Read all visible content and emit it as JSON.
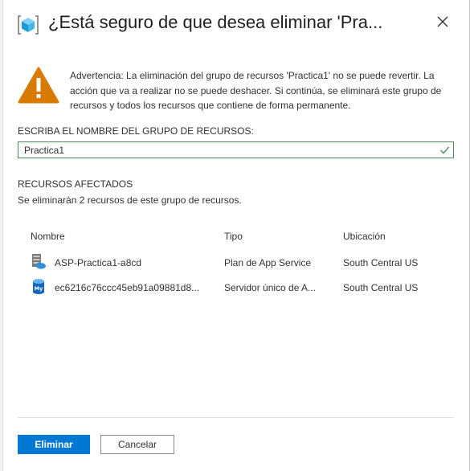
{
  "dialog": {
    "title": "¿Está seguro de que desea eliminar 'Pra...",
    "close_icon": "close-icon"
  },
  "warning": {
    "icon": "warning-icon",
    "color": "#d97a00",
    "text": "Advertencia: La eliminación del grupo de recursos 'Practica1' no se puede revertir. La acción que va a realizar no se puede deshacer. Si continúa, se eliminará este grupo de recursos y todos los recursos que contiene de forma permanente."
  },
  "confirm": {
    "label": "ESCRIBA EL NOMBRE DEL GRUPO DE RECURSOS:",
    "value": "Practica1",
    "valid_icon": "checkmark-icon"
  },
  "affected": {
    "title": "RECURSOS AFECTADOS",
    "description": "Se eliminarán 2 recursos de este grupo de recursos.",
    "columns": [
      "Nombre",
      "Tipo",
      "Ubicación"
    ],
    "rows": [
      {
        "icon": "app-service-plan-icon",
        "name": "ASP-Practica1-a8cd",
        "type": "Plan de App Service",
        "location": "South Central US"
      },
      {
        "icon": "mysql-server-icon",
        "name": "ec6216c76ccc45eb91a09881d8...",
        "type": "Servidor único de A...",
        "location": "South Central US"
      }
    ]
  },
  "footer": {
    "delete_label": "Eliminar",
    "cancel_label": "Cancelar"
  },
  "colors": {
    "accent": "#0078d4",
    "valid": "#4b8a57"
  }
}
